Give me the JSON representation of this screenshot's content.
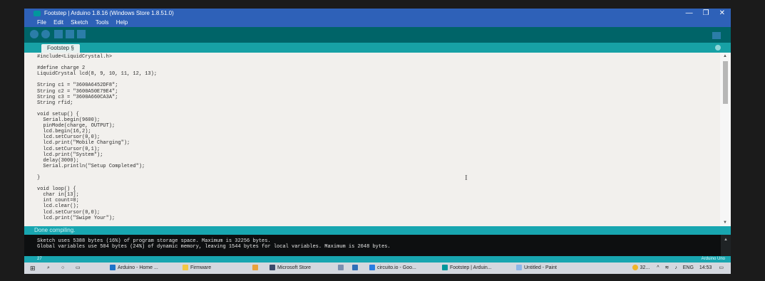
{
  "window": {
    "title": "Footstep | Arduino 1.8.16 (Windows Store 1.8.51.0)",
    "controls": [
      "—",
      "❐",
      "✕"
    ]
  },
  "menu": [
    "File",
    "Edit",
    "Sketch",
    "Tools",
    "Help"
  ],
  "toolbar": {
    "buttons": [
      "verify-icon",
      "upload-icon",
      "new-icon",
      "open-icon",
      "save-icon",
      "serial-monitor-icon"
    ]
  },
  "tab": {
    "label": "Footstep §"
  },
  "code_lines": [
    "#include<LiquidCrystal.h>",
    "",
    "#define charge 2",
    "LiquidCrystal lcd(8, 9, 10, 11, 12, 13);",
    "",
    "String c1 = \"3600A6452DF8\";",
    "String c2 = \"3600A50E79E4\";",
    "String c3 = \"3600A660CA3A\";",
    "String rfid;",
    "",
    "void setup() {",
    "  Serial.begin(9600);",
    "  pinMode(charge, OUTPUT);",
    "  lcd.begin(16,2);",
    "  lcd.setCursor(0,0);",
    "  lcd.print(\"Mobile Charging\");",
    "  lcd.setCursor(0,1);",
    "  lcd.print(\"System\");",
    "  delay(3000);",
    "  Serial.println(\"Setup Completed\");",
    "",
    "}",
    "",
    "void loop() {",
    "  char in[13];",
    "  int count=0;",
    "  lcd.clear();",
    "  lcd.setCursor(0,0);",
    "  lcd.print(\"Swipe Your\");"
  ],
  "status": {
    "message": "Done compiling."
  },
  "console": {
    "lines": [
      "Sketch uses 5388 bytes (16%) of program storage space. Maximum is 32256 bytes.",
      "Global variables use 504 bytes (24%) of dynamic memory, leaving 1544 bytes for local variables. Maximum is 2048 bytes."
    ]
  },
  "line_status": {
    "line": "27",
    "board": "Arduino Uno"
  },
  "taskbar": {
    "items": [
      {
        "label": "Arduino - Home ...",
        "color": "#1e73c8"
      },
      {
        "label": "Firmware",
        "color": "#f2c744"
      },
      {
        "label": "Microsoft Store",
        "color": "#3b4a6b"
      },
      {
        "label": "circuito.io - Goo...",
        "color": "#2a7de1"
      },
      {
        "label": "Footstep | Arduin...",
        "color": "#00979c"
      },
      {
        "label": "Untitled - Paint",
        "color": "#8fb7e8"
      }
    ],
    "tray": {
      "temp": "32...",
      "lang": "ENG",
      "time": "14:53"
    }
  },
  "colors": {
    "titlebar": "#2e61b8",
    "toolbar": "#006468",
    "tabbar": "#17a1a5",
    "editor_bg": "#f2f0ed",
    "console_bg": "#0d0f10"
  }
}
